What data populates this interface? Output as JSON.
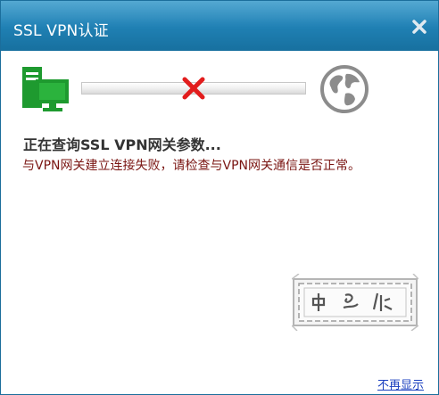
{
  "window": {
    "title": "SSL VPN认证",
    "close_icon": "close-icon"
  },
  "progress": {
    "client_icon": "computer-icon",
    "status_icon": "fail-x-icon",
    "server_icon": "globe-icon",
    "status_color": "#e21d1d",
    "client_color": "#1e9a2f"
  },
  "status": {
    "title": "正在查询SSL VPN网关参数...",
    "error_message": "与VPN网关建立连接失败，请检查与VPN网关通信是否正常。"
  },
  "footer": {
    "dont_show_label": "不再显示"
  },
  "colors": {
    "title_bar": "#2183b7",
    "error_text": "#7a1512",
    "link": "#1a3fbf"
  }
}
